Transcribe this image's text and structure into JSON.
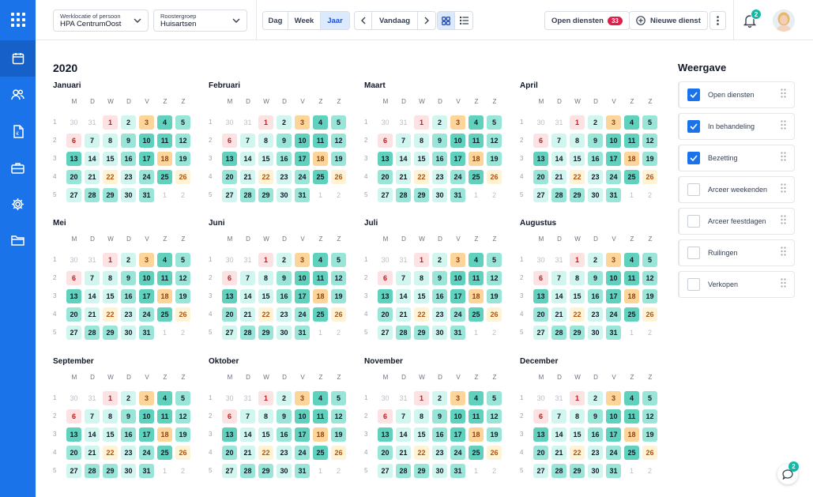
{
  "header": {
    "location_label": "Werklocatie of persoon",
    "location_value": "HPA CentrumOost",
    "group_label": "Roostergroep",
    "group_value": "Huisartsen",
    "view_tabs": [
      "Dag",
      "Week",
      "Jaar"
    ],
    "active_tab": "Jaar",
    "today_label": "Vandaag",
    "open_shifts_label": "Open diensten",
    "open_shifts_count": "33",
    "new_shift_label": "Nieuwe dienst",
    "notification_count": "2"
  },
  "sidebar": {
    "items": [
      "apps-grid-icon",
      "calendar-icon",
      "users-icon",
      "document-icon",
      "briefcase-icon",
      "gear-icon",
      "folder-icon"
    ],
    "active": "calendar-icon"
  },
  "calendar": {
    "year": "2020",
    "weekdays": [
      "M",
      "D",
      "W",
      "D",
      "V",
      "Z",
      "Z"
    ],
    "week_numbers": [
      "1",
      "2",
      "3",
      "4",
      "5"
    ],
    "months": [
      "Januari",
      "Februari",
      "Maart",
      "April",
      "Mei",
      "Juni",
      "Juli",
      "Augustus",
      "September",
      "Oktober",
      "November",
      "December"
    ],
    "rows": [
      [
        [
          "30",
          "g"
        ],
        [
          "31",
          "g"
        ],
        [
          "1",
          "r"
        ],
        [
          "2",
          "t1"
        ],
        [
          "3",
          "o"
        ],
        [
          "4",
          "t3"
        ],
        [
          "5",
          "t2"
        ]
      ],
      [
        [
          "6",
          "r"
        ],
        [
          "7",
          "t1"
        ],
        [
          "8",
          "t1"
        ],
        [
          "9",
          "t2"
        ],
        [
          "10",
          "t3"
        ],
        [
          "11",
          "t3"
        ],
        [
          "12",
          "t2"
        ]
      ],
      [
        [
          "13",
          "t3"
        ],
        [
          "14",
          "t1"
        ],
        [
          "15",
          "t1"
        ],
        [
          "16",
          "t2"
        ],
        [
          "17",
          "t3"
        ],
        [
          "18",
          "o"
        ],
        [
          "19",
          "t2"
        ]
      ],
      [
        [
          "20",
          "t2"
        ],
        [
          "21",
          "t1"
        ],
        [
          "22",
          "l"
        ],
        [
          "23",
          "t1"
        ],
        [
          "24",
          "t2"
        ],
        [
          "25",
          "t3"
        ],
        [
          "26",
          "l"
        ]
      ],
      [
        [
          "27",
          "t1"
        ],
        [
          "28",
          "t2"
        ],
        [
          "29",
          "t2"
        ],
        [
          "30",
          "t1"
        ],
        [
          "31",
          "t2"
        ],
        [
          "1",
          "g"
        ],
        [
          "2",
          "g"
        ]
      ]
    ]
  },
  "weergave": {
    "title": "Weergave",
    "items": [
      {
        "label": "Open diensten",
        "checked": true
      },
      {
        "label": "In behandeling",
        "checked": true
      },
      {
        "label": "Bezetting",
        "checked": true
      },
      {
        "label": "Arceer weekenden",
        "checked": false
      },
      {
        "label": "Arceer feestdagen",
        "checked": false
      },
      {
        "label": "Ruilingen",
        "checked": false
      },
      {
        "label": "Verkopen",
        "checked": false
      }
    ]
  },
  "chat": {
    "badge": "2"
  },
  "colors": {
    "brand": "#1a73e8",
    "accent": "#14b8a6",
    "alert": "#e11d48"
  }
}
